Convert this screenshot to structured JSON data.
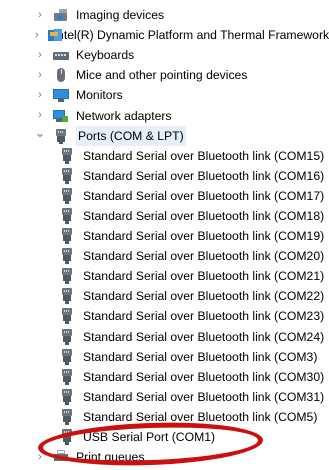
{
  "categories_top": [
    {
      "label": "Imaging devices",
      "icon": "camera-icon",
      "expanded": false
    },
    {
      "label": "Intel(R) Dynamic Platform and Thermal Framework",
      "icon": "intel-chip-icon",
      "expanded": false
    },
    {
      "label": "Keyboards",
      "icon": "keyboard-icon",
      "expanded": false
    },
    {
      "label": "Mice and other pointing devices",
      "icon": "mouse-icon",
      "expanded": false
    },
    {
      "label": "Monitors",
      "icon": "monitor-icon",
      "expanded": false
    },
    {
      "label": "Network adapters",
      "icon": "network-adapter-icon",
      "expanded": false
    }
  ],
  "ports": {
    "label": "Ports (COM & LPT)",
    "icon": "port-icon",
    "expanded": true,
    "children": [
      "Standard Serial over Bluetooth link (COM15)",
      "Standard Serial over Bluetooth link (COM16)",
      "Standard Serial over Bluetooth link (COM17)",
      "Standard Serial over Bluetooth link (COM18)",
      "Standard Serial over Bluetooth link (COM19)",
      "Standard Serial over Bluetooth link (COM20)",
      "Standard Serial over Bluetooth link (COM21)",
      "Standard Serial over Bluetooth link (COM22)",
      "Standard Serial over Bluetooth link (COM23)",
      "Standard Serial over Bluetooth link (COM24)",
      "Standard Serial over Bluetooth link (COM3)",
      "Standard Serial over Bluetooth link (COM30)",
      "Standard Serial over Bluetooth link (COM31)",
      "Standard Serial over Bluetooth link (COM5)",
      "USB Serial Port (COM1)"
    ]
  },
  "categories_bottom": [
    {
      "label": "Print queues",
      "icon": "printer-icon",
      "expanded": false
    }
  ],
  "chevron_collapsed": "›",
  "chevron_expanded": "⌄",
  "colors": {
    "annotation": "#cc0f0f",
    "selection": "#e5f0fb",
    "chevron": "#7a7a7a"
  }
}
